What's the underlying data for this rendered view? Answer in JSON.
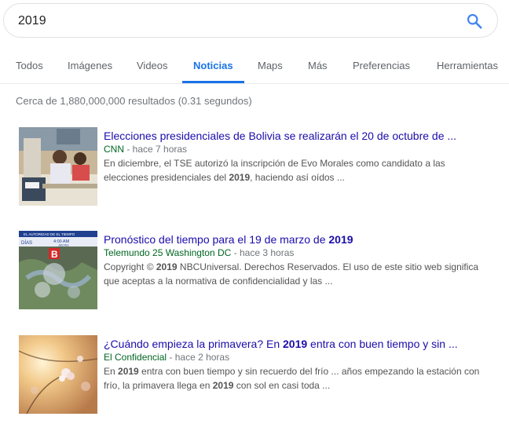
{
  "search": {
    "query": "2019"
  },
  "tabs": [
    {
      "label": "Todos"
    },
    {
      "label": "Imágenes"
    },
    {
      "label": "Videos"
    },
    {
      "label": "Noticias",
      "active": true
    },
    {
      "label": "Maps"
    },
    {
      "label": "Más"
    },
    {
      "label": "Preferencias"
    },
    {
      "label": "Herramientas"
    }
  ],
  "stats": "Cerca de 1,880,000,000 resultados (0.31 segundos)",
  "results": [
    {
      "title": "Elecciones presidenciales de Bolivia se realizarán el 20 de octubre de ...",
      "source": "CNN",
      "time": "hace 7 horas",
      "snippet_parts": [
        {
          "text": "En diciembre, el TSE autorizó la inscripción de Evo Morales como candidato a las elecciones presidenciales del ",
          "bold": false
        },
        {
          "text": "2019",
          "bold": true
        },
        {
          "text": ", haciendo así oídos ...",
          "bold": false
        }
      ]
    },
    {
      "title": "Pronóstico del tiempo para el 19 de marzo de ",
      "title_bold": "2019",
      "source": "Telemundo 25 Washington DC",
      "time": "hace 3 horas",
      "snippet_parts": [
        {
          "text": "Copyright © ",
          "bold": false
        },
        {
          "text": "2019",
          "bold": true
        },
        {
          "text": " NBCUniversal. Derechos Reservados. El uso de este sitio web significa que aceptas a la normativa de confidencialidad y las ...",
          "bold": false
        }
      ],
      "thumb_text": {
        "banner": "EL AUTORIDAD DE EL TIEMPO",
        "day": "DÍAS",
        "clock": "4:00 AM",
        "day2": "JUEVES"
      }
    },
    {
      "title": "¿Cuándo empieza la primavera? En ",
      "title_bold": "2019",
      "title_after": " entra con buen tiempo y sin ...",
      "source": "El Confidencial",
      "time": "hace 2 horas",
      "snippet_parts": [
        {
          "text": "En ",
          "bold": false
        },
        {
          "text": "2019",
          "bold": true
        },
        {
          "text": " entra con buen tiempo y sin recuerdo del frío ... años empezando la estación con frío, la primavera llega en ",
          "bold": false
        },
        {
          "text": "2019",
          "bold": true
        },
        {
          "text": " con sol en casi toda ...",
          "bold": false
        }
      ]
    }
  ],
  "meta_separator": " - ",
  "colors": {
    "accent": "#1a73e8",
    "link": "#1a0dab",
    "source": "#006621",
    "muted": "#70757a"
  },
  "icons": {
    "search": "search-icon"
  }
}
